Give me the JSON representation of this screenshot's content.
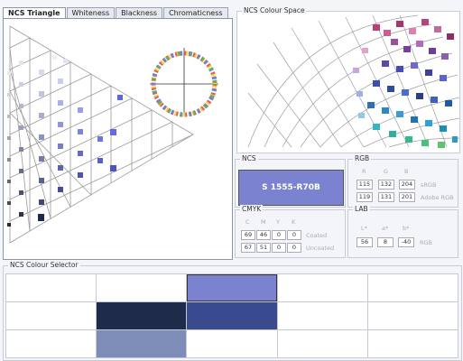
{
  "tabs": [
    {
      "label": "NCS Triangle",
      "active": true
    },
    {
      "label": "Whiteness",
      "active": false
    },
    {
      "label": "Blackness",
      "active": false
    },
    {
      "label": "Chromaticness",
      "active": false
    }
  ],
  "colour_space": {
    "title": "NCS Colour Space"
  },
  "ncs": {
    "title": "NCS",
    "code": "S 1555-R70B",
    "color": "#7b82cf"
  },
  "rgb": {
    "title": "RGB",
    "headers": [
      "R",
      "G",
      "B"
    ],
    "rows": [
      {
        "values": [
          "115",
          "132",
          "204"
        ],
        "label": "sRGB"
      },
      {
        "values": [
          "119",
          "131",
          "201"
        ],
        "label": "Adobe RGB"
      }
    ]
  },
  "cmyk": {
    "title": "CMYK",
    "headers": [
      "C",
      "M",
      "Y",
      "K"
    ],
    "rows": [
      {
        "values": [
          "69",
          "46",
          "0",
          "0"
        ],
        "label": "Coated"
      },
      {
        "values": [
          "67",
          "51",
          "0",
          "0"
        ],
        "label": "Uncoated"
      }
    ]
  },
  "lab": {
    "title": "LAB",
    "headers": [
      "L*",
      "a*",
      "b*"
    ],
    "rows": [
      {
        "values": [
          "56",
          "8",
          "-40"
        ],
        "label": "RGB"
      }
    ]
  },
  "selector": {
    "title": "NCS Colour Selector",
    "cells": [
      {
        "color": "#ffffff"
      },
      {
        "color": "#ffffff"
      },
      {
        "color": "#7b82cf",
        "selected": true
      },
      {
        "color": "#ffffff"
      },
      {
        "color": "#ffffff"
      },
      {
        "color": "#ffffff"
      },
      {
        "color": "#1f2b4a"
      },
      {
        "color": "#3a4a8f"
      },
      {
        "color": "#ffffff"
      },
      {
        "color": "#ffffff"
      },
      {
        "color": "#ffffff"
      },
      {
        "color": "#7e8db8"
      },
      {
        "color": "#ffffff"
      },
      {
        "color": "#ffffff"
      },
      {
        "color": "#ffffff"
      }
    ]
  }
}
